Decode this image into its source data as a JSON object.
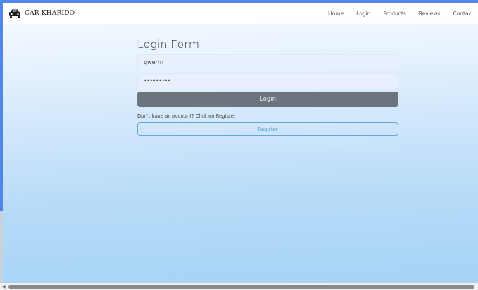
{
  "navbar": {
    "brand": "CAR KHARIDO",
    "links": [
      "Home",
      "Login",
      "Products",
      "Reviews",
      "Contac"
    ]
  },
  "form": {
    "title": "Login Form",
    "username_value": "qwerrrr",
    "password_value": "•••••••••",
    "login_label": "Login",
    "register_hint": "Don't have an account? Click on Register",
    "register_label": "Register"
  },
  "colors": {
    "accent": "#4f86e8",
    "login_button": "#6c757d",
    "register_border": "#6aa7d8"
  }
}
